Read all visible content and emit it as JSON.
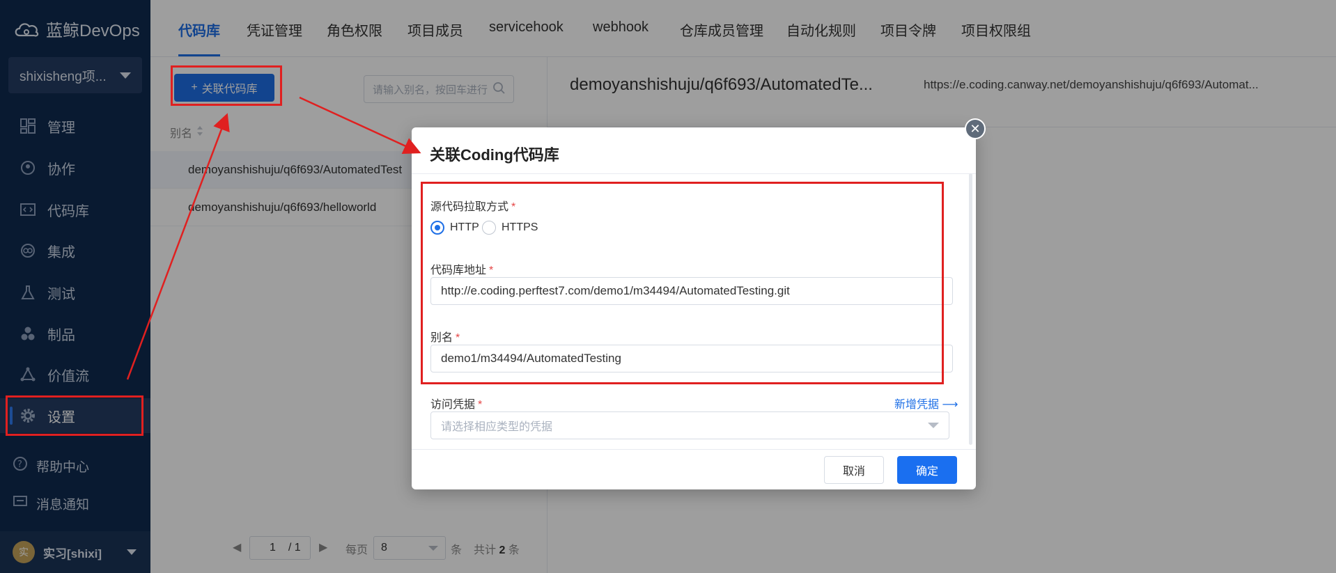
{
  "brand": {
    "name": "蓝鲸DevOps"
  },
  "project": {
    "name": "shixisheng项..."
  },
  "sidebar": {
    "items": [
      {
        "label": "管理",
        "icon": "dashboard-icon"
      },
      {
        "label": "协作",
        "icon": "collab-icon"
      },
      {
        "label": "代码库",
        "icon": "code-icon"
      },
      {
        "label": "集成",
        "icon": "integration-icon"
      },
      {
        "label": "测试",
        "icon": "test-icon"
      },
      {
        "label": "制品",
        "icon": "artifact-icon"
      },
      {
        "label": "价值流",
        "icon": "value-stream-icon"
      },
      {
        "label": "设置",
        "icon": "gear-icon"
      }
    ],
    "help": "帮助中心",
    "notice": "消息通知",
    "user": "实习[shixi]",
    "avatar": "实"
  },
  "tabs": [
    "代码库",
    "凭证管理",
    "角色权限",
    "项目成员",
    "servicehook",
    "webhook",
    "仓库成员管理",
    "自动化规则",
    "项目令牌",
    "项目权限组"
  ],
  "left": {
    "add_button": "关联代码库",
    "search_placeholder": "请输入别名，按回车进行",
    "col_alias": "别名",
    "rows": [
      "demoyanshishuju/q6f693/AutomatedTest",
      "demoyanshishuju/q6f693/helloworld"
    ],
    "pager": {
      "page": "1",
      "total_pages": "/ 1",
      "per_page_label": "每页",
      "per_page": "8",
      "unit": "条",
      "total_label": "共计",
      "total": "2",
      "total_unit": "条"
    }
  },
  "right": {
    "repo_title": "demoyanshishuju/q6f693/AutomatedTe...",
    "repo_url": "https://e.coding.canway.net/demoyanshishuju/q6f693/Automat..."
  },
  "modal": {
    "title": "关联Coding代码库",
    "pull_method_label": "源代码拉取方式",
    "opt_http": "HTTP",
    "opt_https": "HTTPS",
    "repo_url_label": "代码库地址",
    "repo_url_value": "http://e.coding.perftest7.com/demo1/m34494/AutomatedTesting.git",
    "alias_label": "别名",
    "alias_value": "demo1/m34494/AutomatedTesting",
    "cred_label": "访问凭据",
    "cred_new": "新增凭据",
    "cred_placeholder": "请选择相应类型的凭据",
    "cancel": "取消",
    "ok": "确定",
    "required_mark": "*",
    "close": "✕"
  }
}
